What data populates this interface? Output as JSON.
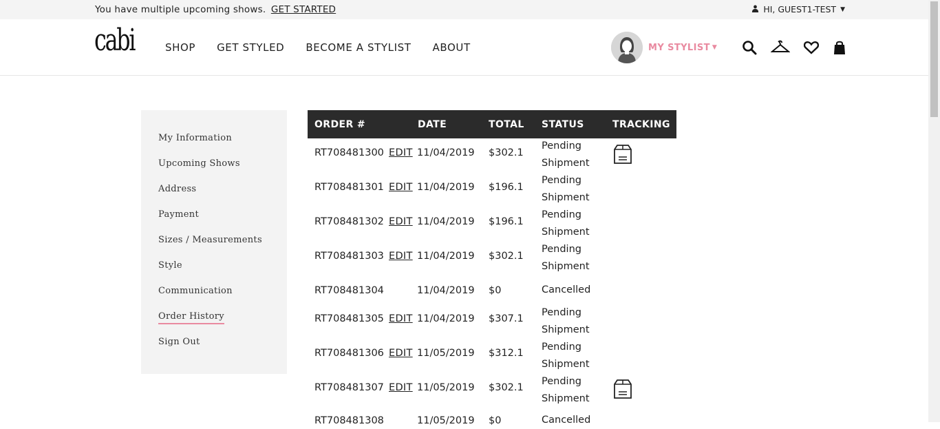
{
  "promo": {
    "text": "You have multiple upcoming shows.",
    "link": "GET STARTED"
  },
  "account": {
    "greeting": "HI, GUEST1-TEST"
  },
  "logo": "cabi",
  "nav": [
    "SHOP",
    "GET STYLED",
    "BECOME A STYLIST",
    "ABOUT"
  ],
  "stylist": {
    "label": "MY STYLIST"
  },
  "sidebar": {
    "items": [
      {
        "label": "My Information"
      },
      {
        "label": "Upcoming Shows"
      },
      {
        "label": "Address"
      },
      {
        "label": "Payment"
      },
      {
        "label": "Sizes / Measurements"
      },
      {
        "label": "Style"
      },
      {
        "label": "Communication"
      },
      {
        "label": "Order History"
      },
      {
        "label": "Sign Out"
      }
    ]
  },
  "table": {
    "headers": [
      "ORDER #",
      "DATE",
      "TOTAL",
      "STATUS",
      "TRACKING"
    ],
    "rows": [
      {
        "order": "RT708481300",
        "edit": "EDIT",
        "date": "11/04/2019",
        "total": "$302.1",
        "status1": "Pending",
        "status2": "Shipment",
        "tracking": true
      },
      {
        "order": "RT708481301",
        "edit": "EDIT",
        "date": "11/04/2019",
        "total": "$196.1",
        "status1": "Pending",
        "status2": "Shipment",
        "tracking": false
      },
      {
        "order": "RT708481302",
        "edit": "EDIT",
        "date": "11/04/2019",
        "total": "$196.1",
        "status1": "Pending",
        "status2": "Shipment",
        "tracking": false
      },
      {
        "order": "RT708481303",
        "edit": "EDIT",
        "date": "11/04/2019",
        "total": "$302.1",
        "status1": "Pending",
        "status2": "Shipment",
        "tracking": false
      },
      {
        "order": "RT708481304",
        "edit": "",
        "date": "11/04/2019",
        "total": "$0",
        "status1": "Cancelled",
        "status2": "",
        "tracking": false
      },
      {
        "order": "RT708481305",
        "edit": "EDIT",
        "date": "11/04/2019",
        "total": "$307.1",
        "status1": "Pending",
        "status2": "Shipment",
        "tracking": false
      },
      {
        "order": "RT708481306",
        "edit": "EDIT",
        "date": "11/05/2019",
        "total": "$312.1",
        "status1": "Pending",
        "status2": "Shipment",
        "tracking": false
      },
      {
        "order": "RT708481307",
        "edit": "EDIT",
        "date": "11/05/2019",
        "total": "$302.1",
        "status1": "Pending",
        "status2": "Shipment",
        "tracking": true
      },
      {
        "order": "RT708481308",
        "edit": "",
        "date": "11/05/2019",
        "total": "$0",
        "status1": "Cancelled",
        "status2": "",
        "tracking": false
      }
    ]
  },
  "colors": {
    "accent": "#e98aa0",
    "header_bg": "#2b2b2b",
    "sidebar_bg": "#f3f3f3",
    "topbar_bg": "#f4f4f4"
  },
  "icons": [
    "user-icon",
    "search-icon",
    "hanger-icon",
    "heart-icon",
    "shopping-bag-icon",
    "package-icon"
  ]
}
